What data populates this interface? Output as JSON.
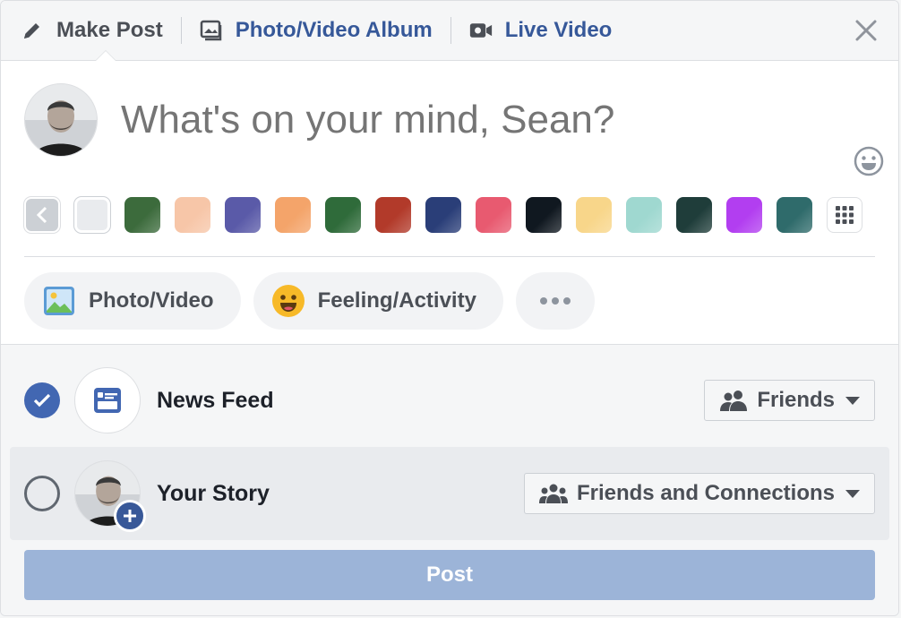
{
  "tabs": {
    "make_post": "Make Post",
    "photo_album": "Photo/Video Album",
    "live_video": "Live Video"
  },
  "composer": {
    "placeholder": "What's on your mind, Sean?",
    "user_name": "Sean"
  },
  "backgrounds": {
    "colors": [
      "#e9ebee",
      "#3c6b3c",
      "#f7c6a8",
      "#5a5aa8",
      "#f4a46a",
      "#2f6b3a",
      "#b23a2a",
      "#2a3e78",
      "#e85a70",
      "#101820",
      "#f8d68a",
      "#9fd8d0",
      "#1f3d3a",
      "#b23ef0",
      "#2f6b6b"
    ]
  },
  "actions": {
    "photo_video": "Photo/Video",
    "feeling_activity": "Feeling/Activity"
  },
  "share": {
    "news_feed": {
      "label": "News Feed",
      "checked": true,
      "audience": "Friends"
    },
    "your_story": {
      "label": "Your Story",
      "checked": false,
      "audience": "Friends and Connections"
    }
  },
  "post_button": "Post",
  "colors": {
    "accent": "#4267b2",
    "link": "#365899",
    "post_disabled": "#9cb4d8"
  }
}
